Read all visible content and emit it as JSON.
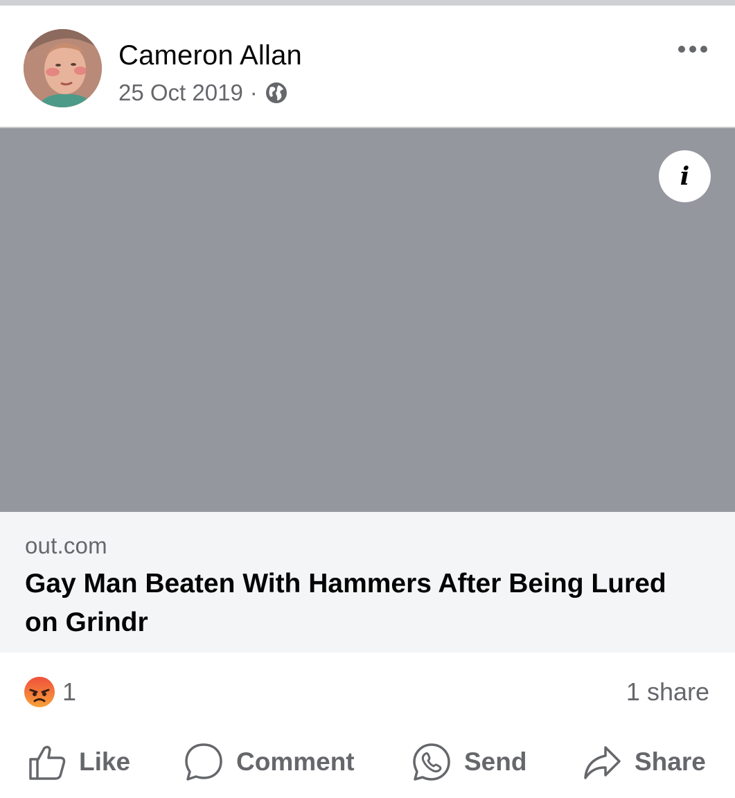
{
  "post": {
    "author": "Cameron Allan",
    "date": "25 Oct 2019",
    "meta_separator": "·",
    "audience_icon": "globe-icon",
    "more_icon": "more-dots-icon"
  },
  "link_preview": {
    "info_label": "i",
    "domain": "out.com",
    "title": "Gay Man Beaten With Hammers After Being Lured on Grindr"
  },
  "engagement": {
    "reaction_icon": "angry-reaction-icon",
    "reaction_count": "1",
    "shares": "1 share"
  },
  "actions": {
    "like": "Like",
    "comment": "Comment",
    "send": "Send",
    "share": "Share"
  },
  "colors": {
    "secondary_text": "#65676b",
    "image_placeholder": "#95979f",
    "caption_background": "#f4f5f7"
  }
}
